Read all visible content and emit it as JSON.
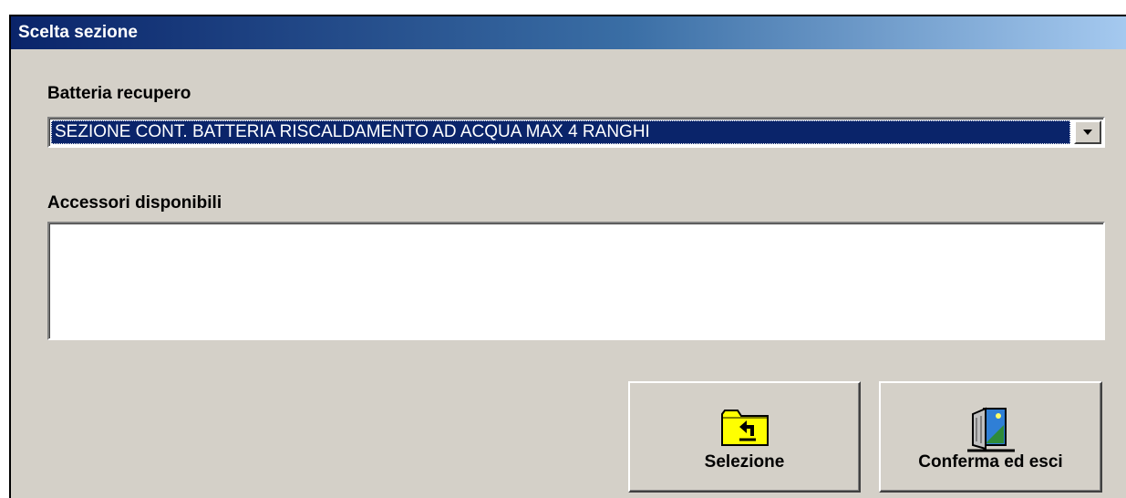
{
  "window": {
    "title": "Scelta sezione"
  },
  "batteria": {
    "label": "Batteria recupero",
    "selected": "SEZIONE CONT.  BATTERIA RISCALDAMENTO AD ACQUA MAX 4 RANGHI"
  },
  "accessori": {
    "label": "Accessori disponibili",
    "items": []
  },
  "buttons": {
    "selezione": {
      "label": "Selezione",
      "icon": "folder-up-icon"
    },
    "conferma": {
      "label": "Conferma ed esci",
      "icon": "exit-door-icon"
    }
  },
  "colors": {
    "title_start": "#0a246a",
    "title_end": "#a6caf0",
    "face": "#d4d0c8",
    "selection": "#0a246a"
  }
}
